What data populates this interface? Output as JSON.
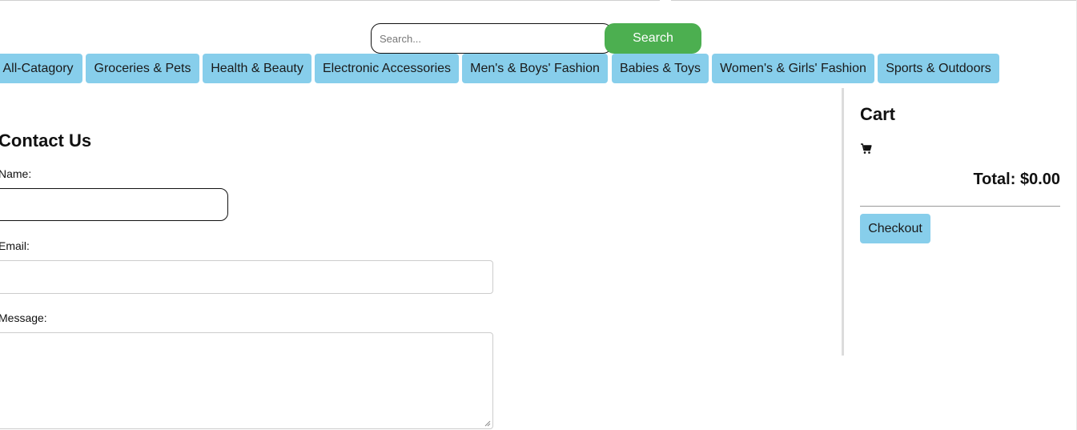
{
  "search": {
    "placeholder": "Search...",
    "button_label": "Search"
  },
  "categories": [
    "All-Catagory",
    "Groceries & Pets",
    "Health & Beauty",
    "Electronic Accessories",
    "Men's & Boys' Fashion",
    "Babies & Toys",
    "Women's & Girls' Fashion",
    "Sports & Outdoors"
  ],
  "contact": {
    "title": "Contact Us",
    "name_label": "Name:",
    "name_value": "",
    "email_label": "Email:",
    "email_value": "",
    "message_label": "Message:",
    "message_value": ""
  },
  "cart": {
    "title": "Cart",
    "icon": "cart-icon",
    "total_text": "Total: $0.00",
    "checkout_label": "Checkout"
  },
  "colors": {
    "category_bg": "#87ceeb",
    "search_button_bg": "#4caf50"
  }
}
